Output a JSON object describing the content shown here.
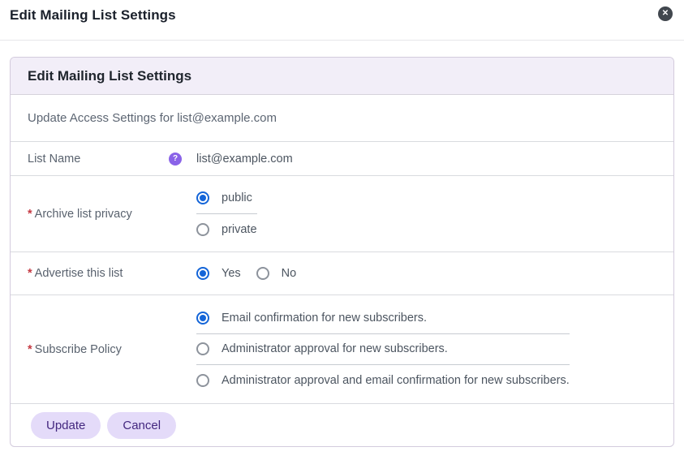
{
  "modal": {
    "title": "Edit Mailing List Settings",
    "close_glyph": "✕"
  },
  "card": {
    "header": "Edit Mailing List Settings",
    "description": "Update Access Settings for list@example.com",
    "list_name": {
      "label": "List Name",
      "help_glyph": "?",
      "value": "list@example.com"
    },
    "archive_privacy": {
      "required": "*",
      "label": "Archive list privacy",
      "options": [
        {
          "label": "public",
          "selected": true
        },
        {
          "label": "private",
          "selected": false
        }
      ]
    },
    "advertise": {
      "required": "*",
      "label": "Advertise this list",
      "options": [
        {
          "label": "Yes",
          "selected": true
        },
        {
          "label": "No",
          "selected": false
        }
      ]
    },
    "subscribe_policy": {
      "required": "*",
      "label": "Subscribe Policy",
      "options": [
        {
          "label": "Email confirmation for new subscribers.",
          "selected": true
        },
        {
          "label": "Administrator approval for new subscribers.",
          "selected": false
        },
        {
          "label": "Administrator approval and email confirmation for new subscribers.",
          "selected": false
        }
      ]
    },
    "footer": {
      "update_label": "Update",
      "cancel_label": "Cancel"
    }
  },
  "colors": {
    "accent_purple": "#8a63e8",
    "radio_selected_blue": "#1465d8",
    "required_red": "#c53a43",
    "card_header_bg": "#f2eef8",
    "button_bg": "#e4dbf9",
    "button_text": "#43277f",
    "close_bg": "#41474e"
  }
}
